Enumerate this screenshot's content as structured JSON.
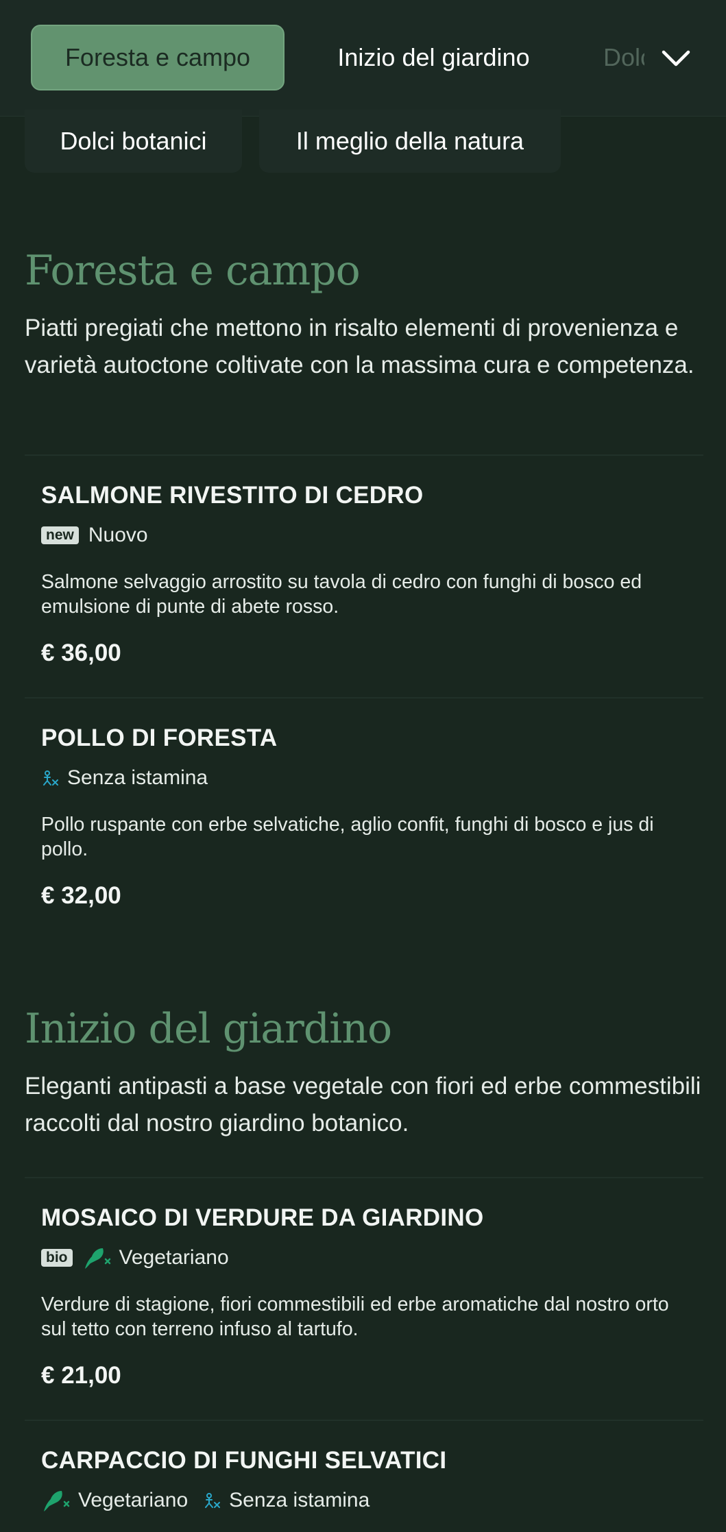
{
  "nav": {
    "tabs": [
      {
        "label": "Foresta e campo"
      },
      {
        "label": "Inizio del giardino"
      },
      {
        "label": "Dolci botanici"
      }
    ],
    "overflow": [
      {
        "label": "Dolci botanici"
      },
      {
        "label": "Il meglio della natura"
      }
    ]
  },
  "sections": [
    {
      "title": "Foresta e campo",
      "description": "Piatti pregiati che mettono in risalto elementi di provenienza e varietà autoctone coltivate con la massima cura e competenza.",
      "items": [
        {
          "name": "SALMONE RIVESTITO DI CEDRO",
          "badge": "new",
          "tag": "Nuovo",
          "description": "Salmone selvaggio arrostito su tavola di cedro con funghi di bosco ed emulsione di punte di abete rosso.",
          "price": "€ 36,00"
        },
        {
          "name": "POLLO DI FORESTA",
          "tag": "Senza istamina",
          "tag_icon": "no-histamine-icon",
          "description": "Pollo ruspante con erbe selvatiche, aglio confit, funghi di bosco e jus di pollo.",
          "price": "€ 32,00"
        }
      ]
    },
    {
      "title": "Inizio del giardino",
      "description": "Eleganti antipasti a base vegetale con fiori ed erbe commestibili raccolti dal nostro giardino botanico.",
      "items": [
        {
          "name": "MOSAICO DI VERDURE DA GIARDINO",
          "badge": "bio",
          "tag": "Vegetariano",
          "tag_icon": "vegetarian-icon",
          "description": "Verdure di stagione, fiori commestibili ed erbe aromatiche dal nostro orto sul tetto con terreno infuso al tartufo.",
          "price": "€ 21,00"
        },
        {
          "name": "CARPACCIO DI FUNGHI SELVATICI",
          "tag": "Vegetariano",
          "tag_icon": "vegetarian-icon",
          "tag2": "Senza istamina",
          "tag2_icon": "no-histamine-icon"
        }
      ]
    }
  ],
  "colors": {
    "background": "#19271f",
    "active_tab": "#62936f",
    "section_title": "#5f9270",
    "vegetarian_icon": "#1ea36d",
    "histamine_icon": "#2aa7c9"
  }
}
